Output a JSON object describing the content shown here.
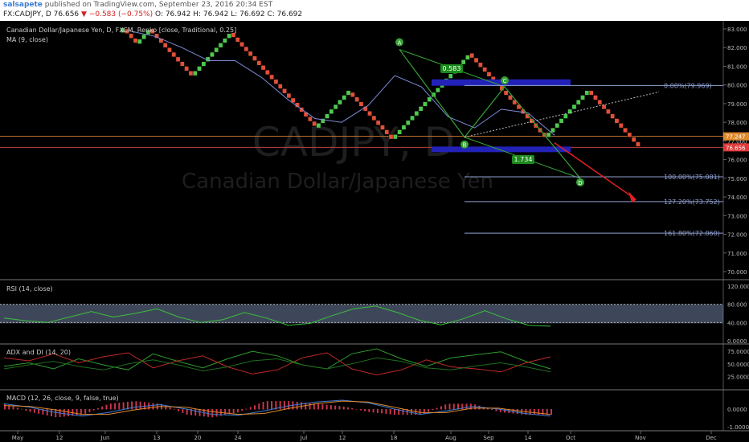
{
  "header": {
    "username": "salsapete",
    "published": "published on TradingView.com, September 23, 2016 20:34 EST",
    "symbol": "FX:CADJPY, D",
    "last": "76.656",
    "change": "▼ −0.583 (−0.75%)",
    "ohlc": "O: 76.942  H: 76.942  L: 76.692  C: 76.692"
  },
  "colors": {
    "up": "#4ec94e",
    "down": "#e0503a",
    "ma": "#7d8bd6",
    "harmonic": "#36a336",
    "fib": "#8fa0d0",
    "zone": "#2222b8",
    "rsi_band": "#8a9ec8",
    "arrow": "#e02020"
  },
  "watermark": {
    "symbol": "CADJPY, D",
    "name": "Canadian Dollar/Japanese Yen"
  },
  "main_legend": {
    "title": "Canadian Dollar/Japanese Yen, D, FXCM, Renko [close, Traditional, 0.25]",
    "ma": "MA (9, close)"
  },
  "panes": {
    "rsi": "RSI (14, close)",
    "adx": "ADX and DI (14, 20)",
    "macd": "MACD (12, 26, close, 9, false, true)"
  },
  "price_axis": {
    "ticks": [
      "83.000",
      "82.000",
      "81.000",
      "80.000",
      "79.000",
      "78.000",
      "77.000",
      "76.000",
      "75.000",
      "74.000",
      "73.000",
      "72.000",
      "71.000",
      "70.000"
    ],
    "tag_orange": "77.247",
    "tag_red": "76.656"
  },
  "rsi_axis": [
    "120.000",
    "80.000",
    "40.000",
    "0.0000"
  ],
  "adx_axis": [
    "75.0000",
    "50.0000",
    "25.0000"
  ],
  "macd_axis": [
    "0.0000",
    "-1.0000"
  ],
  "time_axis": [
    "May",
    "12",
    "Jun",
    "13",
    "20",
    "24",
    "Jul",
    "12",
    "18",
    "Aug",
    "Sep",
    "14",
    "Oct",
    "Nov",
    "Dec"
  ],
  "patterns": {
    "points": [
      "A",
      "B",
      "C",
      "D"
    ],
    "ratio_ac": "0.583",
    "ratio_bd": "1.734"
  },
  "fib_levels": [
    "0.00%(79.969)",
    "100.00%(75.081)",
    "127.20%(73.752)",
    "161.80%(72.060)"
  ],
  "chart_data": {
    "type": "renko",
    "box_size": 0.25,
    "renko_columns": [
      {
        "start": 82.8,
        "end": 83.0
      },
      {
        "start": 83.0,
        "end": 82.2
      },
      {
        "start": 82.2,
        "end": 83.0
      },
      {
        "start": 83.0,
        "end": 80.5
      },
      {
        "start": 80.5,
        "end": 82.8
      },
      {
        "start": 82.8,
        "end": 77.7
      },
      {
        "start": 77.7,
        "end": 79.6
      },
      {
        "start": 79.6,
        "end": 77.1
      },
      {
        "start": 77.1,
        "end": 81.7
      },
      {
        "start": 81.7,
        "end": 77.2
      },
      {
        "start": 77.2,
        "end": 79.7
      },
      {
        "start": 79.7,
        "end": 76.7
      }
    ],
    "ma_series": [
      82.9,
      82.6,
      82.0,
      81.3,
      81.3,
      80.4,
      79.2,
      78.2,
      78.0,
      78.9,
      80.5,
      79.9,
      78.3,
      77.7,
      78.7,
      78.5,
      77.3
    ],
    "rsi_series": [
      50,
      44,
      40,
      52,
      64,
      52,
      60,
      70,
      52,
      40,
      46,
      62,
      50,
      34,
      38,
      55,
      70,
      76,
      62,
      45,
      35,
      48,
      66,
      48,
      34,
      32
    ],
    "adx_plus": [
      45,
      52,
      40,
      60,
      48,
      38,
      70,
      55,
      42,
      60,
      75,
      66,
      48,
      40,
      70,
      80,
      60,
      45,
      62,
      68,
      74,
      55,
      40
    ],
    "adx_minus": [
      62,
      56,
      70,
      52,
      64,
      72,
      42,
      56,
      66,
      44,
      30,
      38,
      62,
      72,
      40,
      28,
      38,
      58,
      44,
      40,
      34,
      52,
      64
    ],
    "adx_line": [
      40,
      48,
      55,
      45,
      38,
      50,
      58,
      48,
      36,
      44,
      56,
      60,
      48,
      40,
      50,
      62,
      55,
      42,
      38,
      46,
      52,
      44,
      34
    ],
    "macd_line": [
      0.3,
      0.1,
      -0.2,
      -0.4,
      -0.2,
      0.1,
      0.25,
      0.0,
      -0.3,
      -0.35,
      -0.1,
      0.2,
      0.4,
      0.5,
      0.35,
      0.0,
      -0.3,
      -0.1,
      0.15,
      0.0,
      -0.25,
      -0.4
    ],
    "macd_signal": [
      0.2,
      0.15,
      -0.05,
      -0.3,
      -0.3,
      -0.05,
      0.15,
      0.1,
      -0.15,
      -0.3,
      -0.25,
      0.05,
      0.3,
      0.45,
      0.4,
      0.1,
      -0.2,
      -0.2,
      0.05,
      0.05,
      -0.15,
      -0.3
    ]
  }
}
